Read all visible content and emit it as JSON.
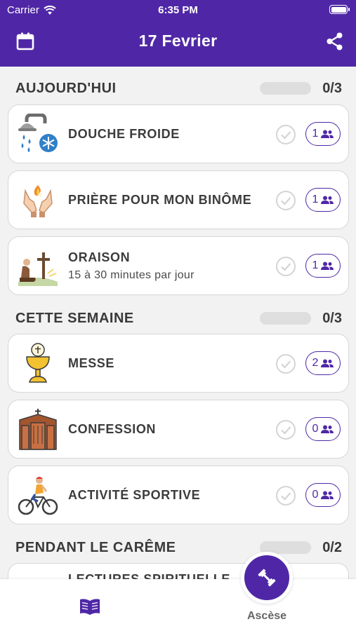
{
  "status_bar": {
    "carrier": "Carrier",
    "time": "6:35 PM"
  },
  "header": {
    "title": "17 Fevrier",
    "left_icon": "calendar-icon",
    "right_icon": "share-icon"
  },
  "colors": {
    "primary": "#4f27a6",
    "background": "#f2f2f2"
  },
  "sections": [
    {
      "title": "AUJOURD'HUI",
      "count": "0/3",
      "items": [
        {
          "title": "DOUCHE FROIDE",
          "subtitle": "",
          "icon": "cold-shower-icon",
          "count": "1"
        },
        {
          "title": "PRIÈRE POUR MON BINÔME",
          "subtitle": "",
          "icon": "praying-hands-icon",
          "count": "1"
        },
        {
          "title": "ORAISON",
          "subtitle": "15 à 30 minutes par jour",
          "icon": "kneeling-prayer-icon",
          "count": "1"
        }
      ]
    },
    {
      "title": "CETTE SEMAINE",
      "count": "0/3",
      "items": [
        {
          "title": "MESSE",
          "subtitle": "",
          "icon": "chalice-icon",
          "count": "2"
        },
        {
          "title": "CONFESSION",
          "subtitle": "",
          "icon": "confessional-icon",
          "count": "0"
        },
        {
          "title": "ACTIVITÉ SPORTIVE",
          "subtitle": "",
          "icon": "cyclist-icon",
          "count": "0"
        }
      ]
    },
    {
      "title": "PENDANT LE CARÊME",
      "count": "0/2",
      "items": [
        {
          "title": "LECTURES SPIRITUELLE",
          "subtitle": "",
          "icon": "",
          "count": ""
        }
      ]
    }
  ],
  "tabbar": {
    "tabs": [
      {
        "icon": "book-icon",
        "label": ""
      },
      {
        "icon": "dumbbell-icon",
        "label": "Ascèse"
      }
    ]
  }
}
